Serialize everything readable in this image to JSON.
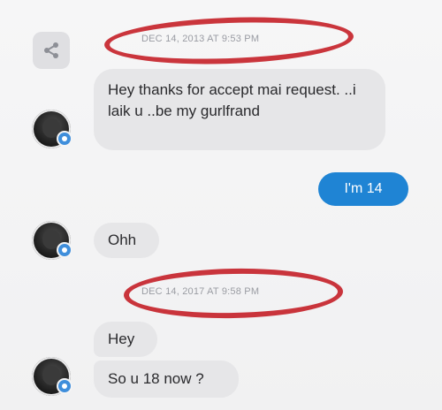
{
  "colors": {
    "incoming_bubble": "#e6e6e8",
    "outgoing_bubble": "#1f84d4",
    "annotation_circle": "#c5242b",
    "timestamp_text": "#9a9ca3"
  },
  "share_button": {
    "icon": "share-icon"
  },
  "timestamps": [
    {
      "text": "DEC 14, 2013 AT 9:53 PM"
    },
    {
      "text": "DEC 14, 2017 AT 9:58 PM"
    }
  ],
  "messages": [
    {
      "direction": "incoming",
      "text": "Hey thanks for accept mai request. ..i laik u ..be my gurlfrand"
    },
    {
      "direction": "outgoing",
      "text": "I'm  14"
    },
    {
      "direction": "incoming",
      "text": "Ohh"
    },
    {
      "direction": "incoming",
      "text": "Hey"
    },
    {
      "direction": "incoming",
      "text": "So u 18 now ?"
    }
  ]
}
